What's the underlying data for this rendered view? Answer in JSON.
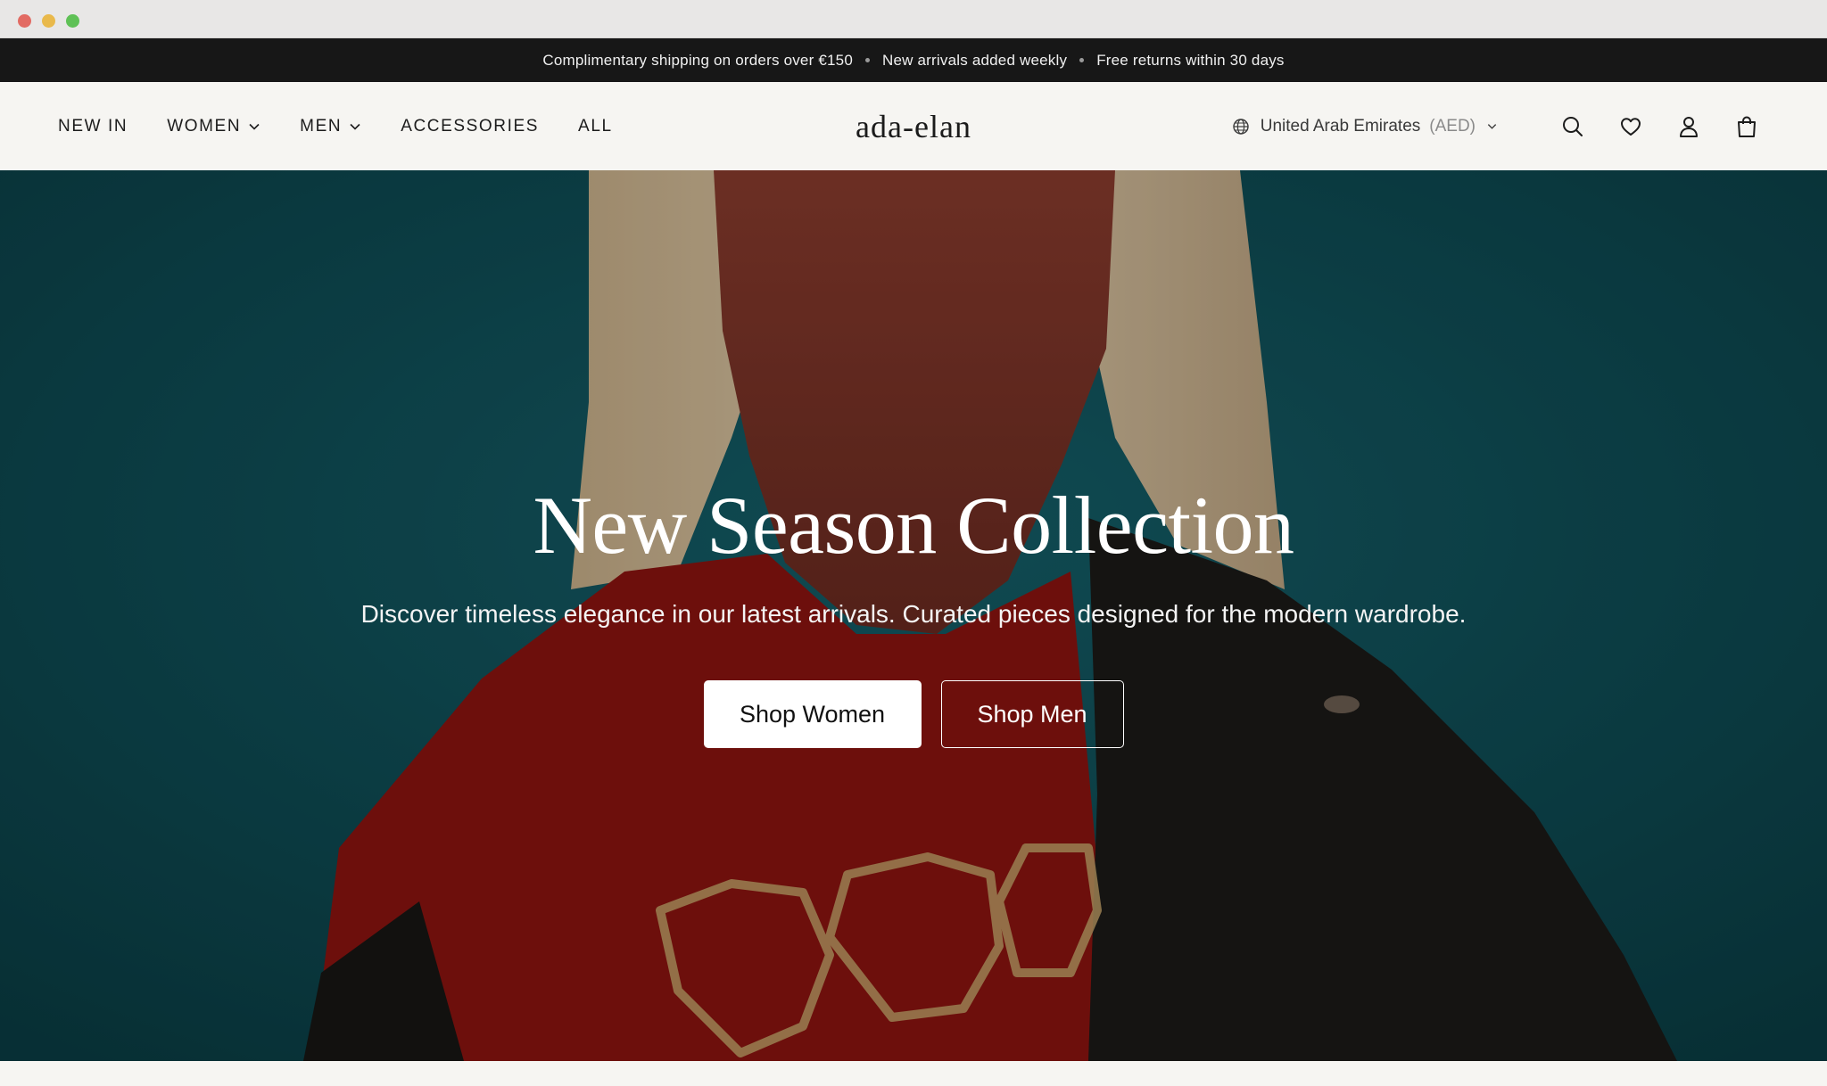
{
  "announcement": {
    "items": [
      "Complimentary shipping on orders over €150",
      "New arrivals added weekly",
      "Free returns within 30 days"
    ]
  },
  "nav": {
    "items": [
      {
        "label": "NEW IN",
        "has_dropdown": false
      },
      {
        "label": "WOMEN",
        "has_dropdown": true
      },
      {
        "label": "MEN",
        "has_dropdown": true
      },
      {
        "label": "ACCESSORIES",
        "has_dropdown": false
      },
      {
        "label": "ALL",
        "has_dropdown": false
      }
    ]
  },
  "brand": {
    "logo_text": "ada-elan"
  },
  "locale": {
    "country": "United Arab Emirates",
    "currency": "(AED)"
  },
  "tools": {
    "icons": [
      "search-icon",
      "heart-icon",
      "user-icon",
      "shopping-bag-icon"
    ]
  },
  "hero": {
    "title": "New Season Collection",
    "subtitle": "Discover timeless elegance in our latest arrivals. Curated pieces designed for the modern wardrobe.",
    "primary_button": "Shop Women",
    "secondary_button": "Shop Men"
  },
  "colors": {
    "announcement_bg": "#171717",
    "header_bg": "#f6f5f2",
    "hero_teal": "#0d4b52",
    "hero_red": "#8c1410",
    "jacket_black": "#1c1a18"
  }
}
